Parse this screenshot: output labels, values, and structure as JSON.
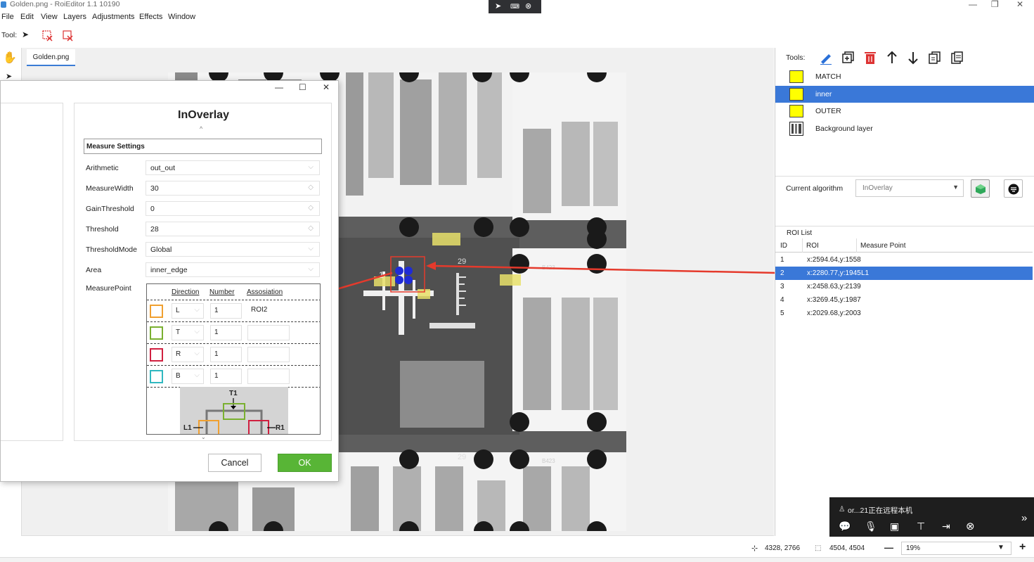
{
  "window": {
    "title": "Golden.png - RoiEditor 1.1 10190",
    "remote_bar_icons": [
      "cursor-icon",
      "keyboard-icon",
      "close-icon"
    ],
    "controls": {
      "minimize": "—",
      "restore": "❐",
      "close": "✕"
    }
  },
  "menu": [
    "File",
    "Edit",
    "View",
    "Layers",
    "Adjustments",
    "Effects",
    "Window"
  ],
  "toolbar": {
    "label": "Tool:"
  },
  "tabs": {
    "active": "Golden.png"
  },
  "right_panel": {
    "tools_label": "Tools:",
    "tool_icons": [
      "pencil-icon",
      "add-layer-icon",
      "trash-icon",
      "arrow-up-icon",
      "arrow-down-icon",
      "copy-icon",
      "paste-icon"
    ],
    "layers": [
      {
        "name": "MATCH",
        "color": "#ffff00",
        "selected": false
      },
      {
        "name": "inner",
        "color": "#ffff00",
        "selected": true
      },
      {
        "name": "OUTER",
        "color": "#ffff00",
        "selected": false
      },
      {
        "name": "Background layer",
        "color": "",
        "selected": false
      }
    ],
    "current_algorithm_label": "Current algorithm",
    "current_algorithm_value": "InOverlay",
    "roi_list": {
      "title": "ROI List",
      "headers": [
        "ID",
        "ROI",
        "Measure Point"
      ],
      "rows": [
        {
          "id": "1",
          "roi": "x:2594.64,y:1558",
          "mp": "",
          "selected": false
        },
        {
          "id": "2",
          "roi": "x:2280.77,y:1945",
          "mp": "L1",
          "selected": true
        },
        {
          "id": "3",
          "roi": "x:2458.63,y:2139",
          "mp": "",
          "selected": false
        },
        {
          "id": "4",
          "roi": "x:3269.45,y:1987",
          "mp": "",
          "selected": false
        },
        {
          "id": "5",
          "roi": "x:2029.68,y:2003",
          "mp": "",
          "selected": false
        }
      ]
    }
  },
  "dialog": {
    "title": "InOverlay",
    "section": "Measure Settings",
    "fields": [
      {
        "label": "Arithmetic",
        "value": "out_out",
        "kind": "select"
      },
      {
        "label": "MeasureWidth",
        "value": "30",
        "kind": "spin"
      },
      {
        "label": "GainThreshold",
        "value": "0",
        "kind": "spin"
      },
      {
        "label": "Threshold",
        "value": "28",
        "kind": "spin"
      },
      {
        "label": "ThresholdMode",
        "value": "Global",
        "kind": "select"
      },
      {
        "label": "Area",
        "value": "inner_edge",
        "kind": "select"
      }
    ],
    "measure_point_label": "MeasurePoint",
    "mp_headers": [
      "Direction",
      "Number",
      "Assosiation"
    ],
    "mp_rows": [
      {
        "color": "#f0a030",
        "direction": "L",
        "number": "1",
        "assoc": "ROI2"
      },
      {
        "color": "#7ab030",
        "direction": "T",
        "number": "1",
        "assoc": ""
      },
      {
        "color": "#d02040",
        "direction": "R",
        "number": "1",
        "assoc": ""
      },
      {
        "color": "#30b8c0",
        "direction": "B",
        "number": "1",
        "assoc": ""
      }
    ],
    "diagram_labels": {
      "top": "T1",
      "left": "L1",
      "right": "R1"
    },
    "cancel": "Cancel",
    "ok": "OK",
    "controls": {
      "minimize": "—",
      "maximize": "☐",
      "close": "✕"
    }
  },
  "image_labels": {
    "label_29_top": "29",
    "label_29_bottom": "29",
    "label_b423_top": "B423",
    "label_b423_bottom": "B423",
    "label_1": "1"
  },
  "status": {
    "cursor": "4328, 2766",
    "size": "4504, 4504",
    "zoom": "19%",
    "zoom_out": "—",
    "zoom_in": "+"
  },
  "remote": {
    "user": "or...21正在远程本机",
    "icons": [
      "chat-icon",
      "mic-icon",
      "screen-icon",
      "text-icon",
      "file-transfer-icon",
      "disconnect-icon"
    ],
    "expand": "»"
  }
}
